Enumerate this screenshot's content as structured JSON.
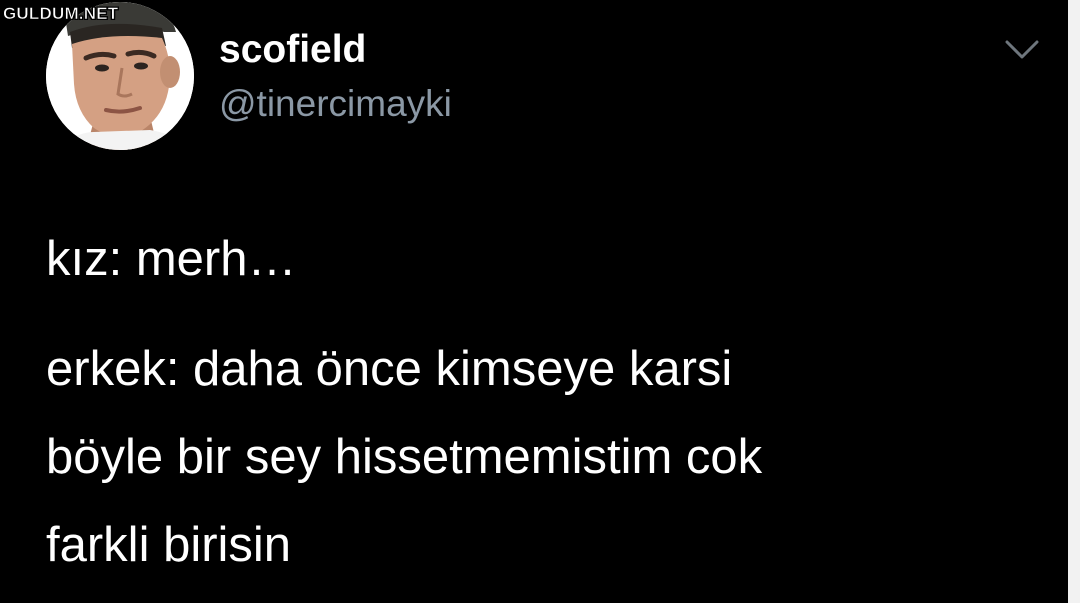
{
  "watermark": "GULDUM.NET",
  "tweet": {
    "author": {
      "display_name": "scofield",
      "handle": "@tinercimayki",
      "avatar_icon": "profile-photo"
    },
    "menu_icon": "chevron-down-icon",
    "lines": [
      "kız: merh…",
      "erkek: daha önce kimseye karsi",
      "böyle bir sey hissetmemistim cok",
      "farkli birisin"
    ]
  },
  "colors": {
    "background": "#000000",
    "text": "#ffffff",
    "secondary_text": "#8b98a5"
  }
}
